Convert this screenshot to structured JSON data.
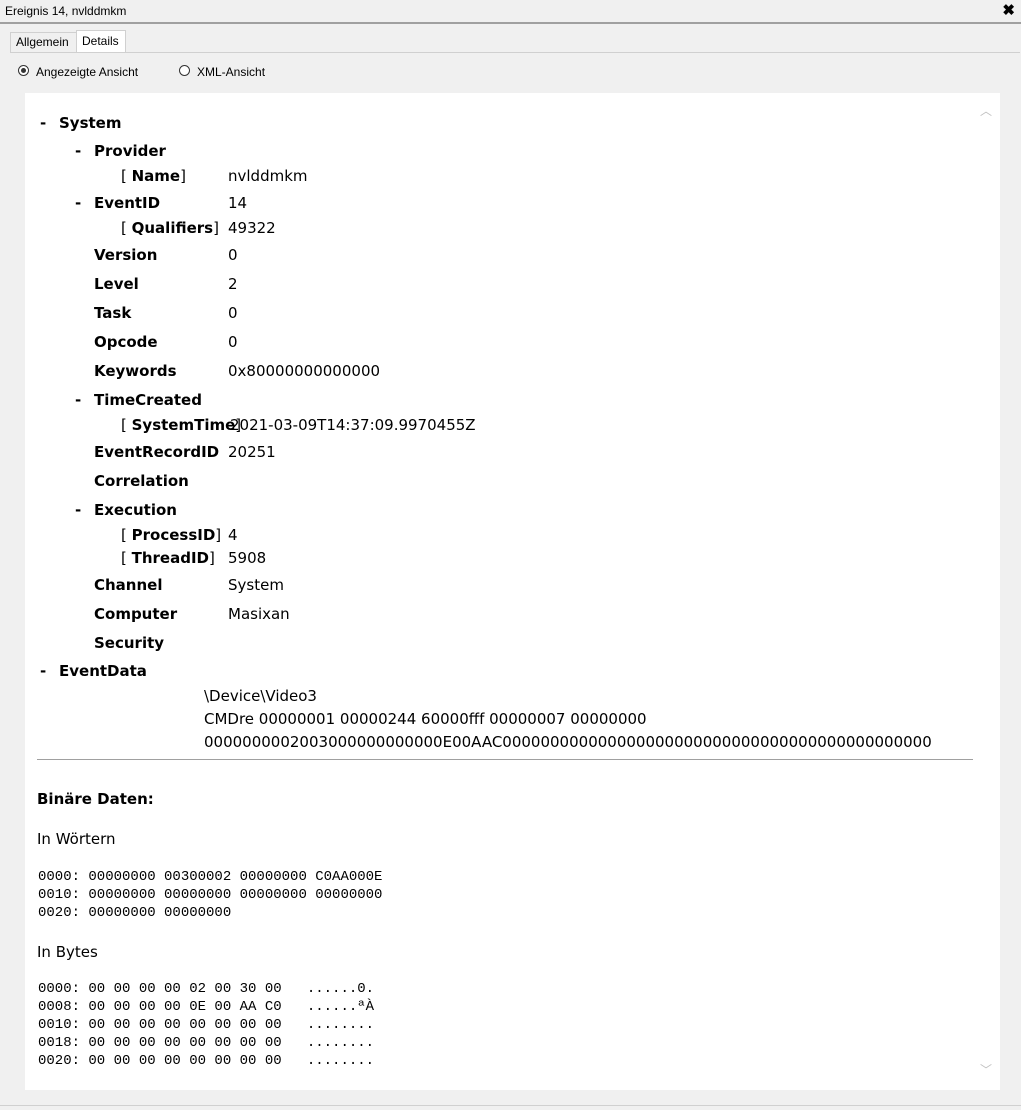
{
  "window": {
    "title": "Ereignis 14, nvlddmkm",
    "close_glyph": "✖"
  },
  "tabs": [
    {
      "label": "Allgemein"
    },
    {
      "label": "Details"
    }
  ],
  "view": {
    "option_1": "Angezeigte Ansicht",
    "option_2": "XML-Ansicht",
    "selected": "Angezeigte Ansicht"
  },
  "tree": {
    "system": {
      "toggle": "-",
      "label": "System"
    },
    "provider": {
      "toggle": "-",
      "label": "Provider",
      "name_attr": "Name",
      "name_value": "nvlddmkm"
    },
    "eventid": {
      "toggle": "-",
      "label": "EventID",
      "value": "14",
      "qualifiers_attr": "Qualifiers",
      "qualifiers_value": "49322"
    },
    "version": {
      "label": "Version",
      "value": "0"
    },
    "level": {
      "label": "Level",
      "value": "2"
    },
    "task": {
      "label": "Task",
      "value": "0"
    },
    "opcode": {
      "label": "Opcode",
      "value": "0"
    },
    "keywords": {
      "label": "Keywords",
      "value": "0x80000000000000"
    },
    "timecreated": {
      "toggle": "-",
      "label": "TimeCreated",
      "systemtime_attr": "SystemTime",
      "systemtime_value": "2021-03-09T14:37:09.9970455Z"
    },
    "eventrecordid": {
      "label": "EventRecordID",
      "value": "20251"
    },
    "correlation": {
      "label": "Correlation"
    },
    "execution": {
      "toggle": "-",
      "label": "Execution",
      "processid_attr": "ProcessID",
      "processid_value": "4",
      "threadid_attr": "ThreadID",
      "threadid_value": "5908"
    },
    "channel": {
      "label": "Channel",
      "value": "System"
    },
    "computer": {
      "label": "Computer",
      "value": "Masixan"
    },
    "security": {
      "label": "Security"
    },
    "eventdata": {
      "toggle": "-",
      "label": "EventData",
      "lines": [
        "\\Device\\Video3",
        "CMDre 00000001 00000244 60000fff 00000007 00000000",
        "0000000002003000000000000E00AAC000000000000000000000000000000000000000000000"
      ]
    }
  },
  "binary": {
    "heading": "Binäre Daten:",
    "words_label": "In Wörtern",
    "words_lines": [
      "0000: 00000000 00300002 00000000 C0AA000E",
      "0010: 00000000 00000000 00000000 00000000",
      "0020: 00000000 00000000"
    ],
    "bytes_label": "In Bytes",
    "bytes_lines": [
      "0000: 00 00 00 00 02 00 30 00   ......0.",
      "0008: 00 00 00 00 0E 00 AA C0   ......ªÀ",
      "0010: 00 00 00 00 00 00 00 00   ........",
      "0018: 00 00 00 00 00 00 00 00   ........",
      "0020: 00 00 00 00 00 00 00 00   ........"
    ]
  },
  "scrollbar": {
    "up_glyph": "︿",
    "down_glyph": "﹀"
  }
}
